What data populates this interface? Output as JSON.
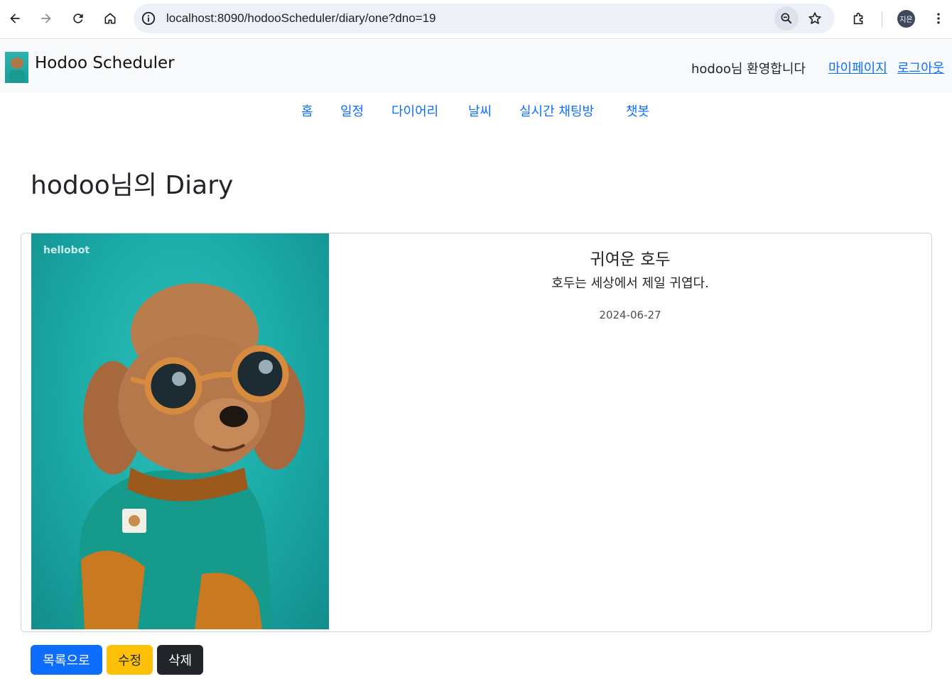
{
  "browser": {
    "url": "localhost:8090/hodooScheduler/diary/one?dno=19",
    "profile_initials": "지은"
  },
  "header": {
    "brand_name": "Hodoo Scheduler",
    "welcome": "hodoo님 환영합니다",
    "mypage_label": "마이페이지",
    "logout_label": "로그아웃"
  },
  "nav": {
    "items": [
      {
        "label": "홈"
      },
      {
        "label": "일정"
      },
      {
        "label": "다이어리"
      },
      {
        "label": "날씨"
      },
      {
        "label": "실시간 채팅방"
      },
      {
        "label": "챗봇"
      }
    ]
  },
  "page": {
    "title": "hodoo님의 Diary"
  },
  "diary": {
    "photo_watermark": "hellobot",
    "title": "귀여운 호두",
    "content": "호두는 세상에서 제일 귀엽다.",
    "date": "2024-06-27"
  },
  "actions": {
    "list_label": "목록으로",
    "edit_label": "수정",
    "delete_label": "삭제"
  },
  "colors": {
    "primary": "#0d6efd",
    "warning": "#ffc107",
    "dark": "#212529",
    "photo_bg": "#1aa9a6"
  }
}
